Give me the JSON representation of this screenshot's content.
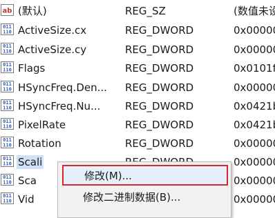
{
  "rows": [
    {
      "name": "(默认)",
      "type": "REG_SZ",
      "data": "(数值未设",
      "icon": "string-value-icon"
    },
    {
      "name": "ActiveSize.cx",
      "type": "REG_DWORD",
      "data": "0x000000",
      "icon": "binary-value-icon"
    },
    {
      "name": "ActiveSize.cy",
      "type": "REG_DWORD",
      "data": "0x000000",
      "icon": "binary-value-icon"
    },
    {
      "name": "Flags",
      "type": "REG_DWORD",
      "data": "0x0101f",
      "icon": "binary-value-icon"
    },
    {
      "name": "HSyncFreq.Den...",
      "type": "REG_DWORD",
      "data": "0x000000",
      "icon": "binary-value-icon"
    },
    {
      "name": "HSyncFreq.Nu...",
      "type": "REG_DWORD",
      "data": "0x0421b",
      "icon": "binary-value-icon"
    },
    {
      "name": "PixelRate",
      "type": "REG_DWORD",
      "data": "0x0421b",
      "icon": "binary-value-icon"
    },
    {
      "name": "Rotation",
      "type": "REG_DWORD",
      "data": "0x000000",
      "icon": "binary-value-icon"
    },
    {
      "name": "Scali",
      "type": "REG_DWORD",
      "data": "0x000000",
      "icon": "binary-value-icon"
    },
    {
      "name": "Sca",
      "type": "",
      "data": "0x000000",
      "icon": "binary-value-icon"
    },
    {
      "name": "Vid",
      "type": "",
      "data": "0x000000",
      "icon": "binary-value-icon"
    }
  ],
  "context_menu": {
    "items": [
      {
        "label": "修改(M)..."
      },
      {
        "label": "修改二进制数据(B)..."
      }
    ]
  },
  "colors": {
    "selection": "#cfe0f7",
    "highlight_border": "#d9252b",
    "icon_blue": "#2f5fb3",
    "icon_red": "#c0392b"
  }
}
